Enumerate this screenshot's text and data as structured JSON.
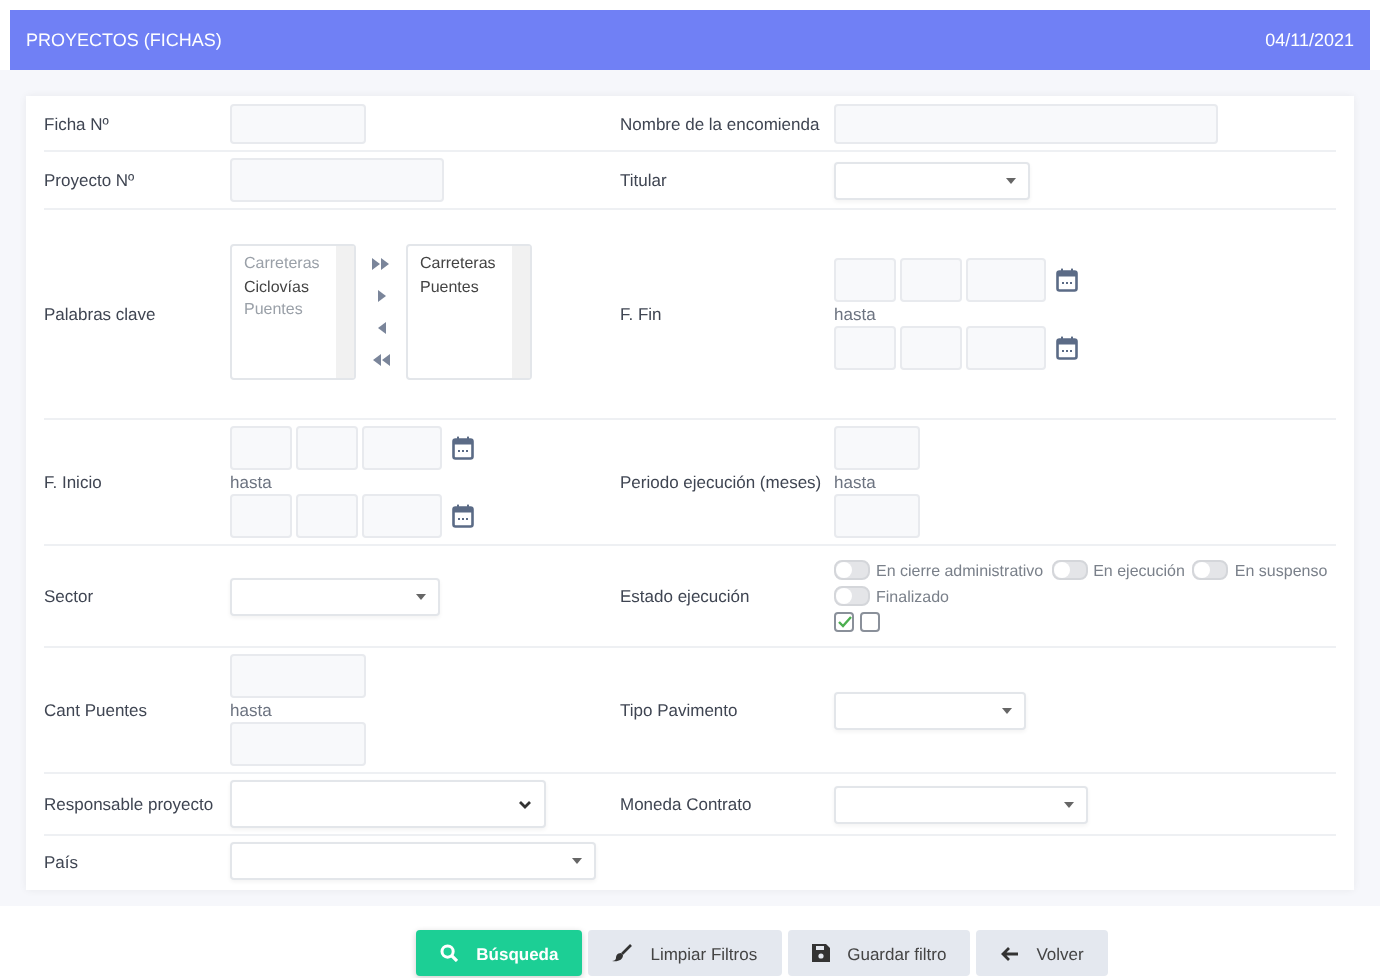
{
  "header": {
    "title": "PROYECTOS (FICHAS)",
    "date": "04/11/2021"
  },
  "rows": [
    {
      "cells": [
        {
          "label": "Ficha Nº",
          "kind": "text"
        },
        {
          "label": "Nombre de la encomienda",
          "kind": "text"
        }
      ]
    },
    {
      "cells": [
        {
          "label": "Proyecto Nº",
          "kind": "text"
        },
        {
          "label": "Titular",
          "kind": "select"
        }
      ]
    },
    {
      "cells": [
        {
          "label": "Palabras clave",
          "kind": "dual_list",
          "available": [
            {
              "text": "Carreteras",
              "disabled": true
            },
            {
              "text": "Ciclovías",
              "disabled": false
            },
            {
              "text": "Puentes",
              "disabled": true
            }
          ],
          "chosen": [
            "Carreteras",
            "Puentes"
          ]
        },
        {
          "label": "F. Fin",
          "kind": "date_range",
          "separator": "hasta"
        }
      ]
    },
    {
      "cells": [
        {
          "label": "F. Inicio",
          "kind": "date_range",
          "separator": "hasta"
        },
        {
          "label": "Periodo ejecución (meses)",
          "kind": "number_range",
          "separator": "hasta"
        }
      ]
    },
    {
      "cells": [
        {
          "label": "Sector",
          "kind": "select"
        },
        {
          "label": "Estado ejecución",
          "kind": "toggles",
          "options": [
            {
              "label": "En cierre administrativo",
              "on": false
            },
            {
              "label": "En ejecución",
              "on": false
            },
            {
              "label": "En suspenso",
              "on": false
            },
            {
              "label": "Finalizado",
              "on": false
            }
          ],
          "checkboxes": [
            {
              "checked": true
            },
            {
              "checked": false
            }
          ]
        }
      ]
    },
    {
      "cells": [
        {
          "label": "Cant Puentes",
          "kind": "number_range",
          "separator": "hasta"
        },
        {
          "label": "Tipo Pavimento",
          "kind": "select"
        }
      ]
    },
    {
      "cells": [
        {
          "label": "Responsable proyecto",
          "kind": "native_select"
        },
        {
          "label": "Moneda Contrato",
          "kind": "select"
        }
      ]
    },
    {
      "cells": [
        {
          "label": "País",
          "kind": "select"
        }
      ]
    }
  ],
  "buttons": [
    {
      "label": "Búsqueda",
      "kind": "search"
    },
    {
      "label": "Limpiar Filtros",
      "kind": "clear"
    },
    {
      "label": "Guardar filtro",
      "kind": "save"
    },
    {
      "label": "Volver",
      "kind": "back"
    }
  ]
}
